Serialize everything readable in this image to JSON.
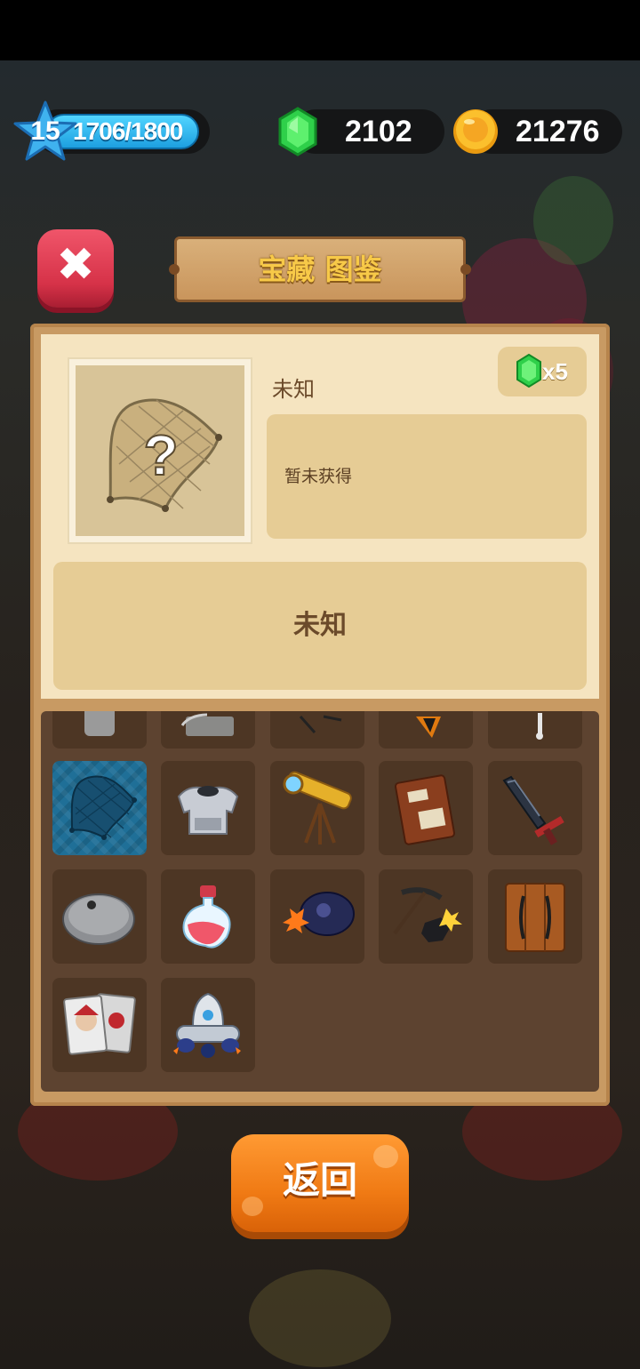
{
  "hud": {
    "level": "15",
    "xp": "1706/1800",
    "gems": "2102",
    "coins": "21276"
  },
  "title": "宝藏 图鉴",
  "detail": {
    "name": "未知",
    "price_label": "x5",
    "description": "暂未获得",
    "unknown_label": "未知"
  },
  "grid": {
    "items": [
      {
        "icon": "gravestone-icon"
      },
      {
        "icon": "chest-icon"
      },
      {
        "icon": "bow-icon"
      },
      {
        "icon": "flame-blade-icon"
      },
      {
        "icon": "bone-icon"
      },
      {
        "icon": "net-icon",
        "selected": true
      },
      {
        "icon": "armor-icon"
      },
      {
        "icon": "telescope-icon"
      },
      {
        "icon": "ancient-book-icon"
      },
      {
        "icon": "broken-sword-icon"
      },
      {
        "icon": "cloche-icon"
      },
      {
        "icon": "potion-icon"
      },
      {
        "icon": "bomb-icon"
      },
      {
        "icon": "pickaxe-icon"
      },
      {
        "icon": "wooden-door-icon"
      },
      {
        "icon": "joker-cards-icon"
      },
      {
        "icon": "robot-ship-icon"
      }
    ]
  },
  "back_button": "返回",
  "colors": {
    "wood_frame": "#c89a63",
    "paper": "#f5e4c0",
    "grid_bg": "#5d4330",
    "close_red": "#d63248",
    "back_orange": "#f07a14",
    "selected_blue": "#1f6f97"
  }
}
